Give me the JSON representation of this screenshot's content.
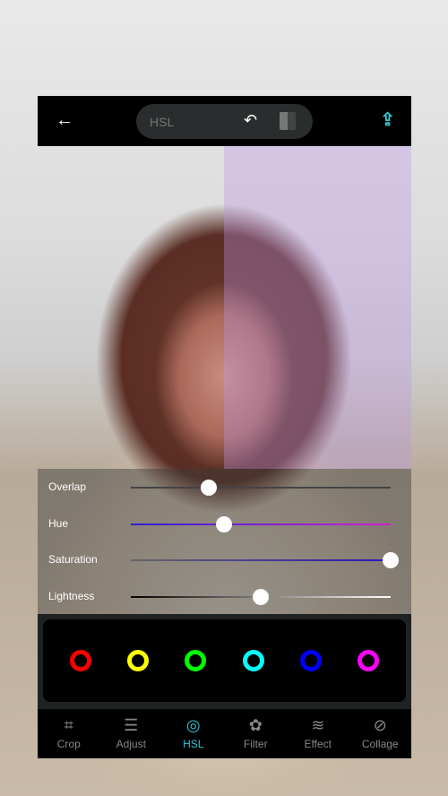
{
  "toolbar": {
    "title": "HSL",
    "back_icon": "arrow-left-icon",
    "undo_icon": "undo-icon",
    "compare_icon": "compare-icon",
    "export_icon": "upload-icon",
    "accent": "#2ec7d4"
  },
  "sliders": [
    {
      "label": "Overlap",
      "value_percent": 30,
      "track": "linear-gradient(90deg,#444,#444)"
    },
    {
      "label": "Hue",
      "value_percent": 36,
      "track": "linear-gradient(90deg,#2b1fd0,#d020d0)"
    },
    {
      "label": "Saturation",
      "value_percent": 100,
      "track": "linear-gradient(90deg,#666,#2a14c0)"
    },
    {
      "label": "Lightness",
      "value_percent": 50,
      "track": "linear-gradient(90deg,#000,#fff)"
    }
  ],
  "colors": [
    "#ff0000",
    "#ffff00",
    "#00ff00",
    "#00ffff",
    "#0000ff",
    "#ff00ff"
  ],
  "selected_color_index": null,
  "nav": [
    {
      "label": "Crop",
      "icon": "crop-icon",
      "glyph": "⌗"
    },
    {
      "label": "Adjust",
      "icon": "sliders-icon",
      "glyph": "☰"
    },
    {
      "label": "HSL",
      "icon": "hsl-icon",
      "glyph": "◎",
      "active": true
    },
    {
      "label": "Filter",
      "icon": "flower-icon",
      "glyph": "✿"
    },
    {
      "label": "Effect",
      "icon": "waves-icon",
      "glyph": "≋"
    },
    {
      "label": "Collage",
      "icon": "collage-icon",
      "glyph": "⊘"
    }
  ]
}
